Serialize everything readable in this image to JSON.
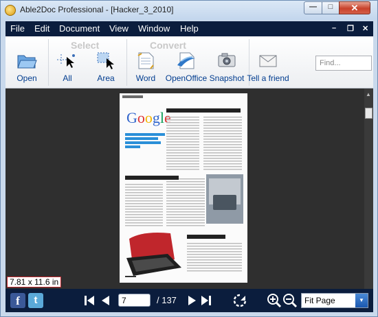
{
  "window": {
    "title": "Able2Doc Professional - [Hacker_3_2010]"
  },
  "menu": {
    "items": [
      "File",
      "Edit",
      "Document",
      "View",
      "Window",
      "Help"
    ]
  },
  "toolbar": {
    "groups": {
      "select": "Select",
      "convert": "Convert"
    },
    "tools": {
      "open": "Open",
      "all": "All",
      "area": "Area",
      "word": "Word",
      "openoffice": "OpenOffice",
      "snapshot": "Snapshot",
      "tell": "Tell a friend"
    },
    "search_placeholder": "Find..."
  },
  "document": {
    "page_size": "7.81 x 11.6 in"
  },
  "navigation": {
    "current_page": "7",
    "total": "/ 137",
    "zoom": "Fit Page"
  },
  "colors": {
    "menubar": "#0b1d3d",
    "toolbar_label": "#003c8f",
    "page_bg": "#2f2f2f",
    "size_border": "#c1272d"
  }
}
